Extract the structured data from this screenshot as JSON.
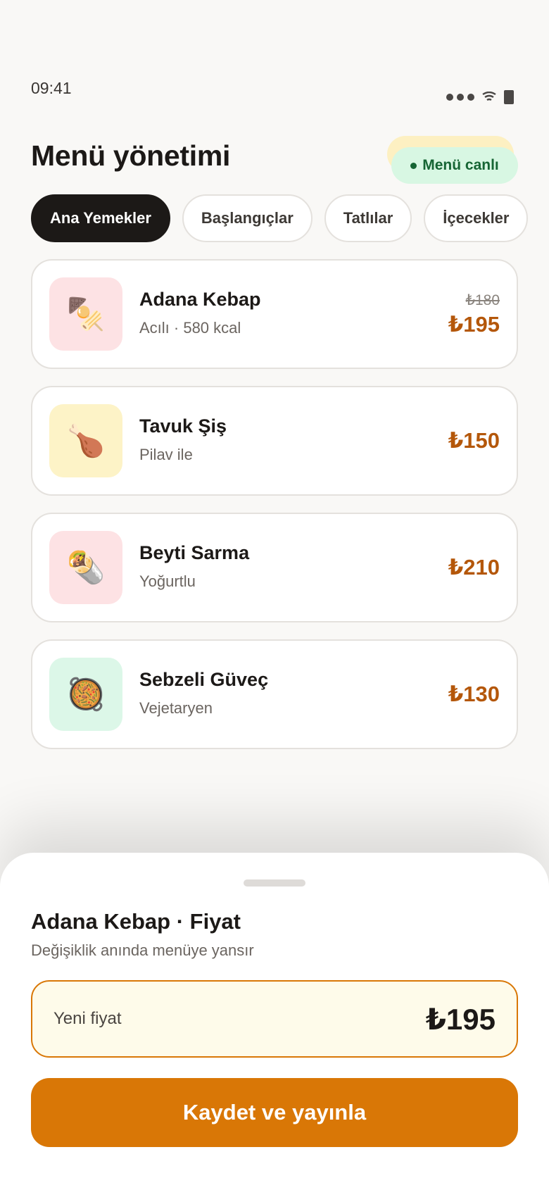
{
  "status_bar": {
    "time": "09:41"
  },
  "header": {
    "title": "Menü yönetimi",
    "live_badge": "Menü canlı"
  },
  "tabs": [
    {
      "label": "Ana Yemekler",
      "active": true
    },
    {
      "label": "Başlangıçlar",
      "active": false
    },
    {
      "label": "Tatlılar",
      "active": false
    },
    {
      "label": "İçecekler",
      "active": false
    }
  ],
  "menu_items": [
    {
      "name": "Adana Kebap",
      "subtitle": "Acılı · 580 kcal",
      "old_price": "₺180",
      "price": "₺195",
      "icon": "kebab-skewer-icon",
      "glyph": "🍢",
      "thumb_color": "#fde2e4"
    },
    {
      "name": "Tavuk Şiş",
      "subtitle": "Pilav ile",
      "old_price": "",
      "price": "₺150",
      "icon": "chicken-leg-icon",
      "glyph": "🍗",
      "thumb_color": "#fdf3c7"
    },
    {
      "name": "Beyti Sarma",
      "subtitle": "Yoğurtlu",
      "old_price": "",
      "price": "₺210",
      "icon": "burrito-wrap-icon",
      "glyph": "🌯",
      "thumb_color": "#fde2e4"
    },
    {
      "name": "Sebzeli Güveç",
      "subtitle": "Vejetaryen",
      "old_price": "",
      "price": "₺130",
      "icon": "casserole-pan-icon",
      "glyph": "🥘",
      "thumb_color": "#dcf7e8"
    }
  ],
  "sheet": {
    "title": "Adana Kebap · Fiyat",
    "subtitle": "Değişiklik anında menüye yansır",
    "field_label": "Yeni fiyat",
    "field_value": "₺195",
    "save_label": "Kaydet ve yayınla"
  },
  "colors": {
    "accent": "#d97706",
    "price": "#b4570a",
    "live": "#166534",
    "dark": "#1c1917"
  }
}
